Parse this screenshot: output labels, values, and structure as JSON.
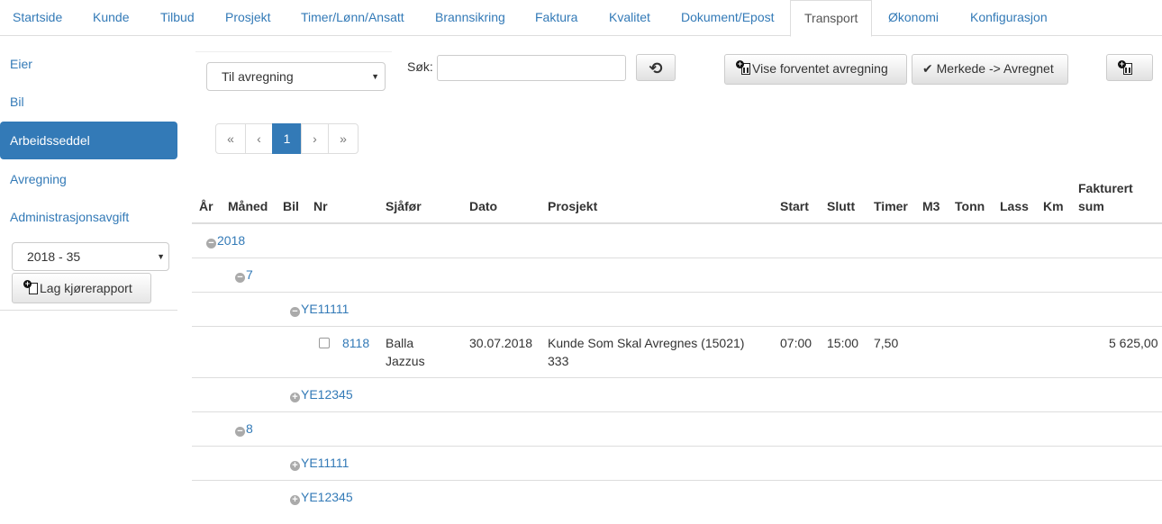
{
  "nav": {
    "tabs": [
      {
        "label": "Startside"
      },
      {
        "label": "Kunde"
      },
      {
        "label": "Tilbud"
      },
      {
        "label": "Prosjekt"
      },
      {
        "label": "Timer/Lønn/Ansatt"
      },
      {
        "label": "Brannsikring"
      },
      {
        "label": "Faktura"
      },
      {
        "label": "Kvalitet"
      },
      {
        "label": "Dokument/Epost"
      },
      {
        "label": "Transport"
      },
      {
        "label": "Økonomi"
      },
      {
        "label": "Konfigurasjon"
      }
    ],
    "active": "Transport"
  },
  "sidebar": {
    "items": [
      {
        "label": "Eier"
      },
      {
        "label": "Bil"
      },
      {
        "label": "Arbeidsseddel"
      },
      {
        "label": "Avregning"
      },
      {
        "label": "Administrasjonsavgift"
      }
    ],
    "active": "Arbeidsseddel",
    "period_select": "2018 - 35",
    "report_button": "Lag kjørerapport"
  },
  "toolbar": {
    "filter_select": "Til avregning",
    "search_label": "Søk:",
    "search_value": "",
    "search_placeholder": "",
    "expected_button": "Vise forventet avregning",
    "mark_button": "Merkede -> Avregnet"
  },
  "pagination": {
    "first": "«",
    "prev": "‹",
    "current": "1",
    "next": "›",
    "last": "»"
  },
  "table": {
    "headers": {
      "year": "År",
      "month": "Måned",
      "car": "Bil",
      "nr": "Nr",
      "driver": "Sjåfør",
      "date": "Dato",
      "project": "Prosjekt",
      "start": "Start",
      "end": "Slutt",
      "hours": "Timer",
      "m3": "M3",
      "tons": "Tonn",
      "loads": "Lass",
      "km": "Km",
      "invoiced_line1": "Fakturert",
      "invoiced_line2": "sum"
    },
    "groups": {
      "year_2018": "2018",
      "month_7": "7",
      "car_a": "YE11111",
      "car_b": "YE12345",
      "month_8": "8",
      "car_c": "YE11111",
      "car_d": "YE12345"
    },
    "row": {
      "nr": "8118",
      "driver_line1": "Balla",
      "driver_line2": "Jazzus",
      "date": "30.07.2018",
      "project_line1": "Kunde Som Skal Avregnes (15021)",
      "project_line2": "333",
      "start": "07:00",
      "end": "15:00",
      "hours": "7,50",
      "invoiced": "5 625,00"
    }
  },
  "icons": {
    "collapse": "−",
    "expand": "+",
    "refresh": "⟲",
    "check": "✔",
    "caret": "▼"
  },
  "colors": {
    "link": "#337ab7",
    "active_bg": "#337ab7",
    "border": "#dddddd"
  }
}
